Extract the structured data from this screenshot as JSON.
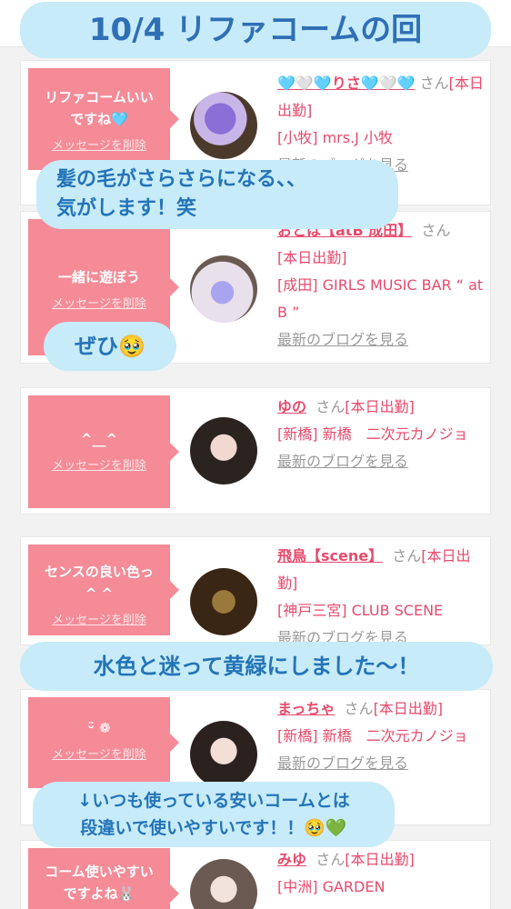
{
  "title": "10/4  リファコームの回",
  "cards": [
    {
      "message": "リファコームいい\nですね🩵",
      "delete_label": "メッセージを削除",
      "name": "🩵🤍🩵りさ🩵🤍🩵",
      "san": "さん",
      "status": "[本日出勤]",
      "shop": "[小牧] mrs.J 小牧",
      "blog": "最新のブログを見る"
    },
    {
      "message": "一緒に遊ぼう",
      "delete_label": "メッセージを削除",
      "name": "おとは【atB 成田】",
      "san": "さん",
      "status": "[本日出勤]",
      "shop": "[成田] GIRLS MUSIC BAR “ at B ”",
      "blog": "最新のブログを見る"
    },
    {
      "message": "^__^",
      "delete_label": "メッセージを削除",
      "name": "ゆの",
      "san": "さん",
      "status": "[本日出勤]",
      "shop": "[新橋] 新橋　二次元カノジョ",
      "blog": "最新のブログを見る"
    },
    {
      "message": "センスの良い色っ\n^ ^",
      "delete_label": "メッセージを削除",
      "name": "飛鳥【scene】",
      "san": "さん",
      "status": "[本日出勤]",
      "shop": "[神戸三宮] CLUB SCENE",
      "blog": "最新のブログを見る"
    },
    {
      "message": "ᵕ̈ ❁",
      "delete_label": "メッセージを削除",
      "name": "まっちゃ",
      "san": "さん",
      "status": "[本日出勤]",
      "shop": "[新橋] 新橋　二次元カノジョ",
      "blog": "最新のブログを見る"
    },
    {
      "message": "コーム使いやすい\nですよね🐰",
      "delete_label": "メッセージを削除",
      "name": "みゆ",
      "san": "さん",
      "status": "[本日出勤]",
      "shop": "[中洲] GARDEN",
      "blog": ""
    }
  ],
  "bubbles": {
    "b1": "髪の毛がさらさらになる、、\n気がします！笑",
    "b2": "ぜひ🥹",
    "b3": "水色と迷って黄緑にしました〜！",
    "b4": "↓いつも使っている安いコームとは\n段違いで使いやすいです！！🥹💚"
  },
  "colors": {
    "accent_pink": "#f48b97",
    "name_pink": "#e84a6c",
    "bubble_blue": "#c7ebf8",
    "bubble_text": "#2474b8"
  }
}
